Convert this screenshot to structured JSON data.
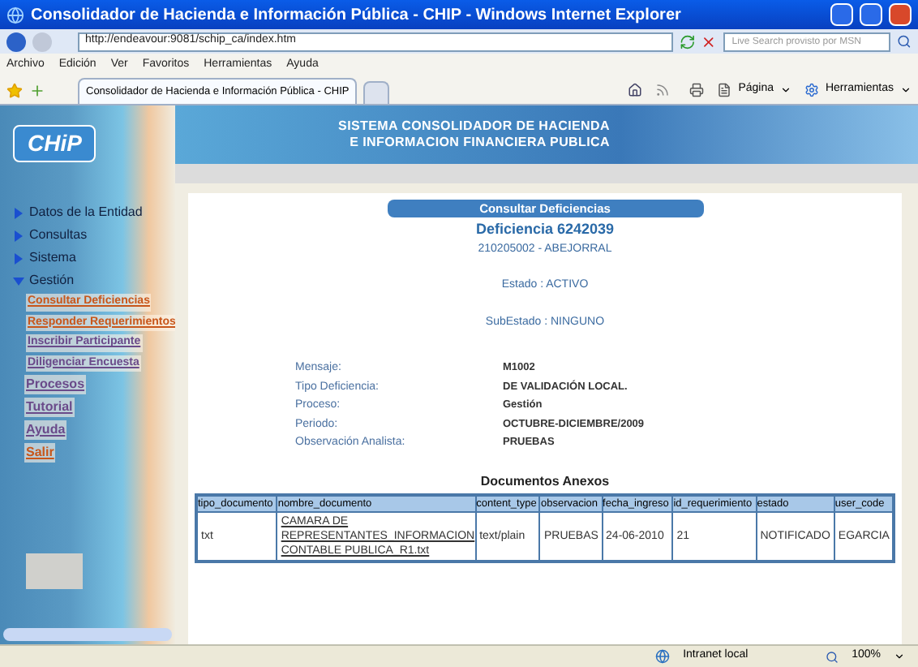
{
  "window": {
    "title": "Consolidador de Hacienda e Información Pública - CHIP - Windows Internet Explorer"
  },
  "address_bar": {
    "url": "http://endeavour:9081/schip_ca/index.htm"
  },
  "search": {
    "placeholder": "Live Search provisto por MSN"
  },
  "menu_bar": [
    "Archivo",
    "Edición",
    "Ver",
    "Favoritos",
    "Herramientas",
    "Ayuda"
  ],
  "tabs": [
    {
      "label": "Consolidador de Hacienda e Información Pública - CHIP",
      "selected": true
    }
  ],
  "toolbar": {
    "page_menu": "Página",
    "tools_menu": "Herramientas"
  },
  "banner": {
    "logo": "CHiP",
    "title_lines": [
      "SISTEMA CONSOLIDADOR DE HACIENDA",
      "E INFORMACION FINANCIERA PUBLICA"
    ]
  },
  "sidebar": {
    "items": [
      {
        "label": "Datos de la Entidad",
        "kind": "folder",
        "expanded": false
      },
      {
        "label": "Consultas",
        "kind": "folder",
        "expanded": false
      },
      {
        "label": "Sistema",
        "kind": "folder",
        "expanded": false
      },
      {
        "label": "Gestión",
        "kind": "folder",
        "expanded": true,
        "children": [
          {
            "label": "Consultar Deficiencias",
            "color": "#c8561a"
          },
          {
            "label": "Responder Requerimientos",
            "color": "#c8561a"
          },
          {
            "label": "Inscribir Participante",
            "color": "#6a4a8a"
          },
          {
            "label": "Diligenciar Encuesta",
            "color": "#6a4a8a"
          }
        ]
      },
      {
        "label": "Procesos",
        "kind": "link",
        "color": "#6a4a8a"
      },
      {
        "label": "Tutorial",
        "kind": "link",
        "color": "#6a4a8a"
      },
      {
        "label": "Ayuda",
        "kind": "link",
        "color": "#6a4a8a"
      },
      {
        "label": "Salir",
        "kind": "link",
        "color": "#c8561a"
      }
    ]
  },
  "panel": {
    "title": "Consultar Deficiencias",
    "heading": "Deficiencia 6242039",
    "entity": "210205002 - ABEJORRAL",
    "estado": "Estado : ACTIVO",
    "subestado": "SubEstado : NINGUNO",
    "fields": [
      {
        "label": "Mensaje:",
        "value": "M1002"
      },
      {
        "label": "Tipo Deficiencia:",
        "value": "DE VALIDACIÓN LOCAL."
      },
      {
        "label": "Proceso:",
        "value": "Gestión"
      },
      {
        "label": "Periodo:",
        "value": "OCTUBRE-DICIEMBRE/2009"
      },
      {
        "label": "Observación Analista:",
        "value": "PRUEBAS"
      }
    ]
  },
  "documents": {
    "title": "Documentos Anexos",
    "columns": [
      "tipo_documento",
      "nombre_documento",
      "content_type",
      "observacion",
      "fecha_ingreso",
      "id_requerimiento",
      "estado",
      "user_code"
    ],
    "rows": [
      [
        "txt",
        "CAMARA DE REPRESENTANTES_INFORMACION CONTABLE PUBLICA_R1.txt",
        "text/plain",
        "PRUEBAS",
        "24-06-2010",
        "21",
        "NOTIFICADO",
        "EGARCIA"
      ]
    ]
  },
  "status_bar": {
    "zone": "Intranet local",
    "zoom": "100%"
  }
}
